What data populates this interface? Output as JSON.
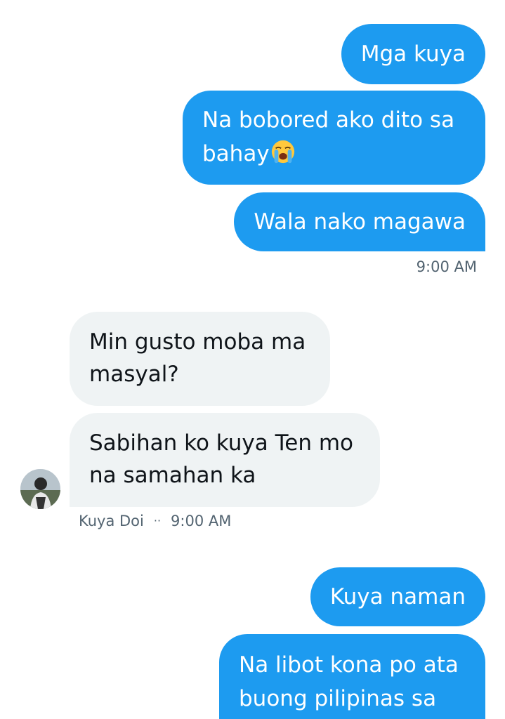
{
  "conversation": {
    "sent_group_1": {
      "messages": [
        "Mga kuya",
        "Na bobored ako dito sa",
        "bahay",
        "Wala nako magawa"
      ],
      "emoji": "loudly-crying-face",
      "timestamp": "9:00 AM"
    },
    "received_group": {
      "messages": [
        [
          "Min gusto moba ma",
          "masyal?"
        ],
        [
          "Sabihan ko kuya Ten mo",
          "na samahan ka"
        ]
      ],
      "sender_name": "Kuya Doi",
      "separator": "··",
      "timestamp": "9:00 AM"
    },
    "sent_group_2": {
      "messages": [
        "Kuya naman",
        [
          "Na libot kona po ata",
          "buong pilipinas sa"
        ]
      ]
    }
  },
  "colors": {
    "sent_bubble": "#1d9bf0",
    "received_bubble": "#eff3f4",
    "meta_text": "#536471"
  }
}
